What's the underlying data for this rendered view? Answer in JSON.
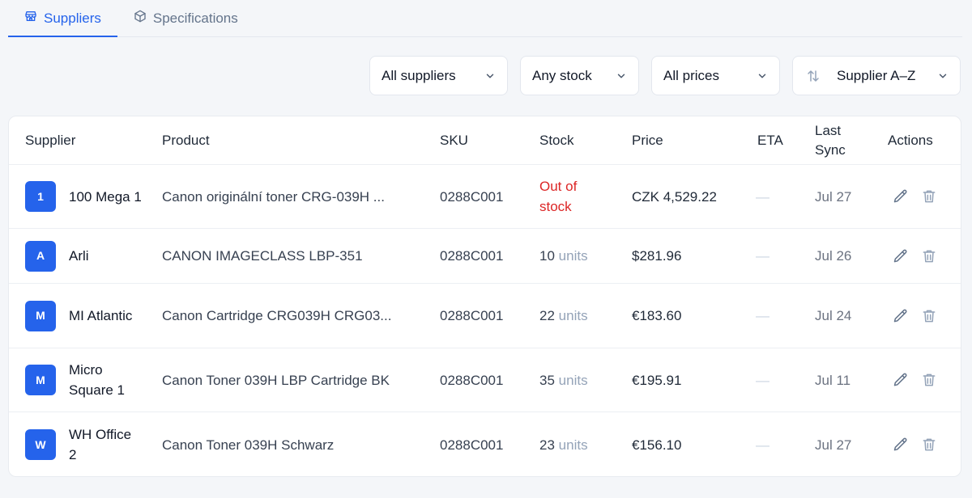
{
  "tabs": [
    {
      "label": "Suppliers",
      "icon": "store-icon",
      "active": true
    },
    {
      "label": "Specifications",
      "icon": "cube-icon",
      "active": false
    }
  ],
  "filters": {
    "supplier": "All suppliers",
    "stock": "Any stock",
    "price": "All prices",
    "sort": "Supplier A–Z"
  },
  "columns": {
    "supplier": "Supplier",
    "product": "Product",
    "sku": "SKU",
    "stock": "Stock",
    "price": "Price",
    "eta": "ETA",
    "last_sync": "Last Sync",
    "actions": "Actions"
  },
  "rows": [
    {
      "initial": "1",
      "supplier": "100 Mega 1",
      "product": "Canon originální toner CRG-039H ...",
      "sku": "0288C001",
      "stock_label": "Out of stock",
      "stock_qty": "",
      "stock_unit": "",
      "price": "CZK 4,529.22",
      "eta": "—",
      "sync": "Jul 27"
    },
    {
      "initial": "A",
      "supplier": "Arli",
      "product": "CANON IMAGECLASS LBP-351",
      "sku": "0288C001",
      "stock_label": "",
      "stock_qty": "10",
      "stock_unit": "units",
      "price": "$281.96",
      "eta": "—",
      "sync": "Jul 26"
    },
    {
      "initial": "M",
      "supplier": "MI Atlantic",
      "product": "Canon Cartridge CRG039H CRG03...",
      "sku": "0288C001",
      "stock_label": "",
      "stock_qty": "22",
      "stock_unit": "units",
      "price": "€183.60",
      "eta": "—",
      "sync": "Jul 24"
    },
    {
      "initial": "M",
      "supplier": "Micro Square 1",
      "product": "Canon Toner 039H LBP Cartridge BK",
      "sku": "0288C001",
      "stock_label": "",
      "stock_qty": "35",
      "stock_unit": "units",
      "price": "€195.91",
      "eta": "—",
      "sync": "Jul 11"
    },
    {
      "initial": "W",
      "supplier": "WH Office 2",
      "product": "Canon Toner 039H Schwarz",
      "sku": "0288C001",
      "stock_label": "",
      "stock_qty": "23",
      "stock_unit": "units",
      "price": "€156.10",
      "eta": "—",
      "sync": "Jul 27"
    }
  ],
  "colors": {
    "accent": "#2563eb",
    "out_of_stock": "#dc2626",
    "muted": "#94a3b8"
  }
}
